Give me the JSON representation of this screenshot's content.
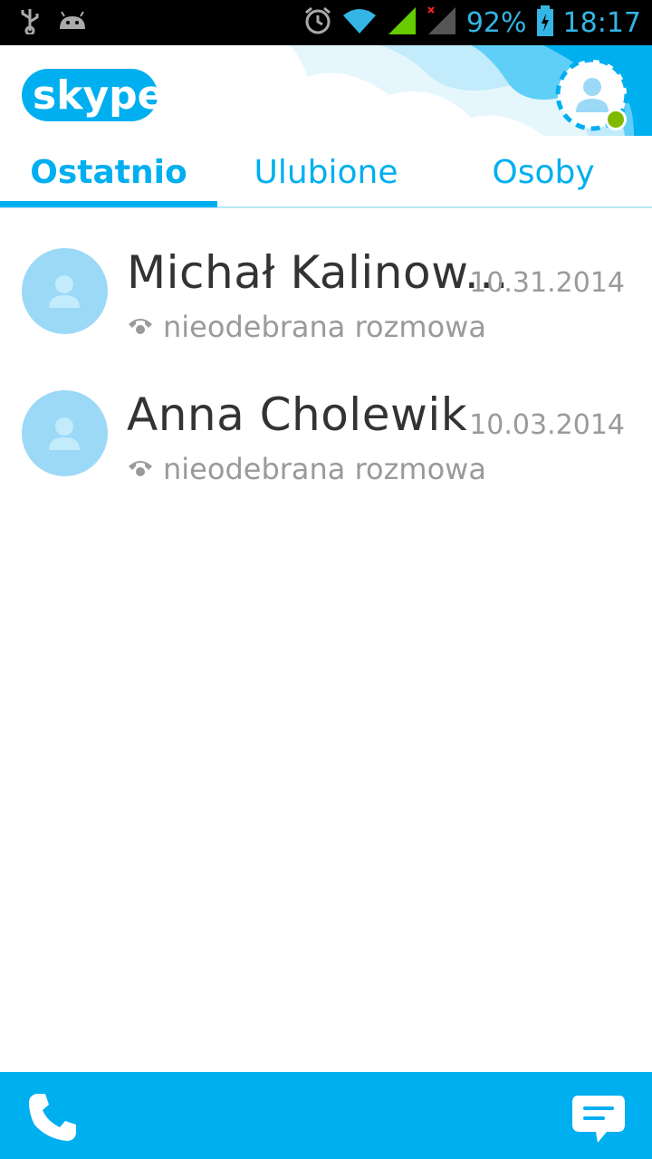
{
  "status_bar": {
    "battery": "92%",
    "time": "18:17",
    "icons": [
      "usb-icon",
      "android-icon",
      "alarm-icon",
      "wifi-icon",
      "signal-icon",
      "signal-no-data-icon",
      "battery-charging-icon"
    ]
  },
  "header": {
    "logo_text": "skype",
    "avatar_status": "online"
  },
  "tabs": [
    {
      "label": "Ostatnio",
      "active": true
    },
    {
      "label": "Ulubione",
      "active": false
    },
    {
      "label": "Osoby",
      "active": false
    }
  ],
  "recent": [
    {
      "name": "Michał Kalinow...",
      "date": "10.31.2014",
      "status": "nieodebrana rozmowa",
      "icon": "missed-call-icon"
    },
    {
      "name": "Anna Cholewik",
      "date": "10.03.2014",
      "status": "nieodebrana rozmowa",
      "icon": "missed-call-icon"
    }
  ],
  "bottom_bar": {
    "icons": [
      "phone-icon",
      "chat-icon"
    ]
  },
  "colors": {
    "accent": "#00aff0",
    "status_bar_icon": "#33b5e5",
    "online": "#7fba00"
  }
}
